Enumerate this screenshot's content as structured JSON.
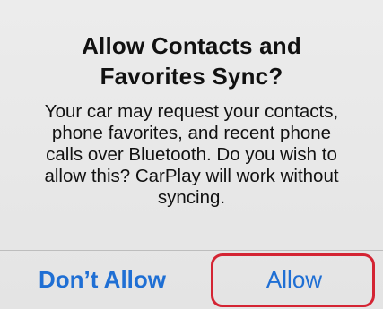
{
  "dialog": {
    "title_line1": "Allow Contacts and",
    "title_line2": "Favorites Sync?",
    "message_lines": [
      "Your car may request your contacts,",
      "phone favorites, and recent phone",
      "calls over Bluetooth. Do you wish to",
      "allow this? CarPlay will work without",
      "syncing."
    ],
    "buttons": {
      "dont_allow": "Don’t Allow",
      "allow": "Allow"
    }
  },
  "colors": {
    "button_text": "#1f6fd4",
    "highlight_outline": "#d42433",
    "background": "#e6e6e6"
  }
}
